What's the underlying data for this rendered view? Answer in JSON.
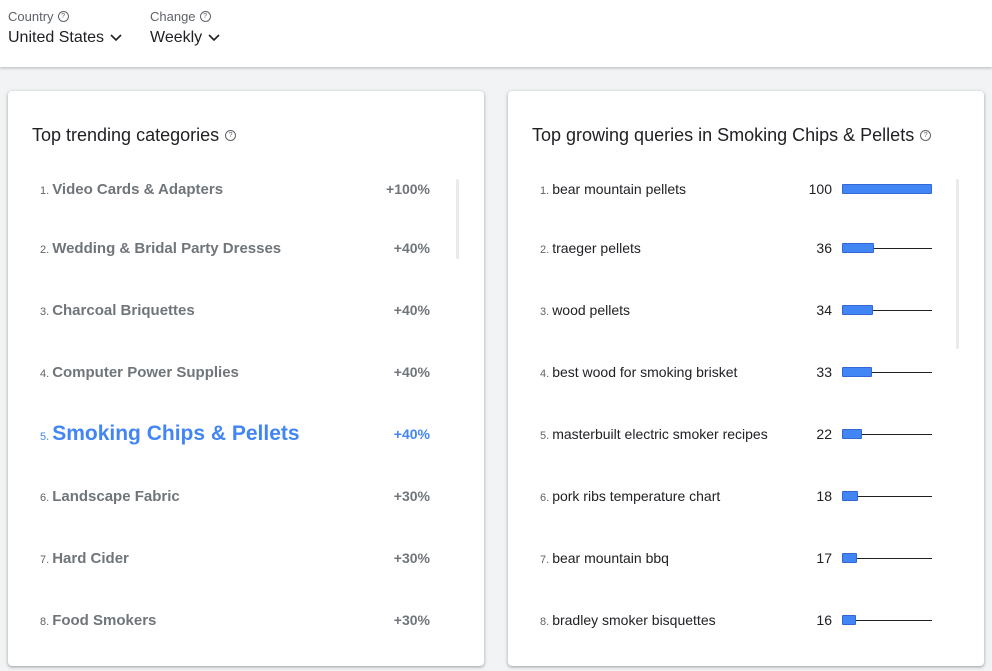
{
  "filters": {
    "country": {
      "label": "Country",
      "value": "United States"
    },
    "change": {
      "label": "Change",
      "value": "Weekly"
    }
  },
  "icons": {
    "help": "help-circle-icon",
    "dropdown": "chevron-down-icon"
  },
  "colors": {
    "accent": "#4285f4",
    "text": "#202124",
    "muted": "#70757a",
    "background": "#f1f3f4"
  },
  "categories": {
    "title": "Top trending categories",
    "items": [
      {
        "rank": "1.",
        "label": "Video Cards & Adapters",
        "change": "+100%"
      },
      {
        "rank": "2.",
        "label": "Wedding & Bridal Party Dresses",
        "change": "+40%"
      },
      {
        "rank": "3.",
        "label": "Charcoal Briquettes",
        "change": "+40%"
      },
      {
        "rank": "4.",
        "label": "Computer Power Supplies",
        "change": "+40%"
      },
      {
        "rank": "5.",
        "label": "Smoking Chips & Pellets",
        "change": "+40%",
        "selected": true
      },
      {
        "rank": "6.",
        "label": "Landscape Fabric",
        "change": "+30%"
      },
      {
        "rank": "7.",
        "label": "Hard Cider",
        "change": "+30%"
      },
      {
        "rank": "8.",
        "label": "Food Smokers",
        "change": "+30%"
      }
    ]
  },
  "queries": {
    "title": "Top growing queries in Smoking Chips & Pellets",
    "items": [
      {
        "rank": "1.",
        "label": "bear mountain pellets",
        "value": 100
      },
      {
        "rank": "2.",
        "label": "traeger pellets",
        "value": 36
      },
      {
        "rank": "3.",
        "label": "wood pellets",
        "value": 34
      },
      {
        "rank": "4.",
        "label": "best wood for smoking brisket",
        "value": 33
      },
      {
        "rank": "5.",
        "label": "masterbuilt electric smoker recipes",
        "value": 22
      },
      {
        "rank": "6.",
        "label": "pork ribs temperature chart",
        "value": 18
      },
      {
        "rank": "7.",
        "label": "bear mountain bbq",
        "value": 17
      },
      {
        "rank": "8.",
        "label": "bradley smoker bisquettes",
        "value": 16
      }
    ]
  }
}
